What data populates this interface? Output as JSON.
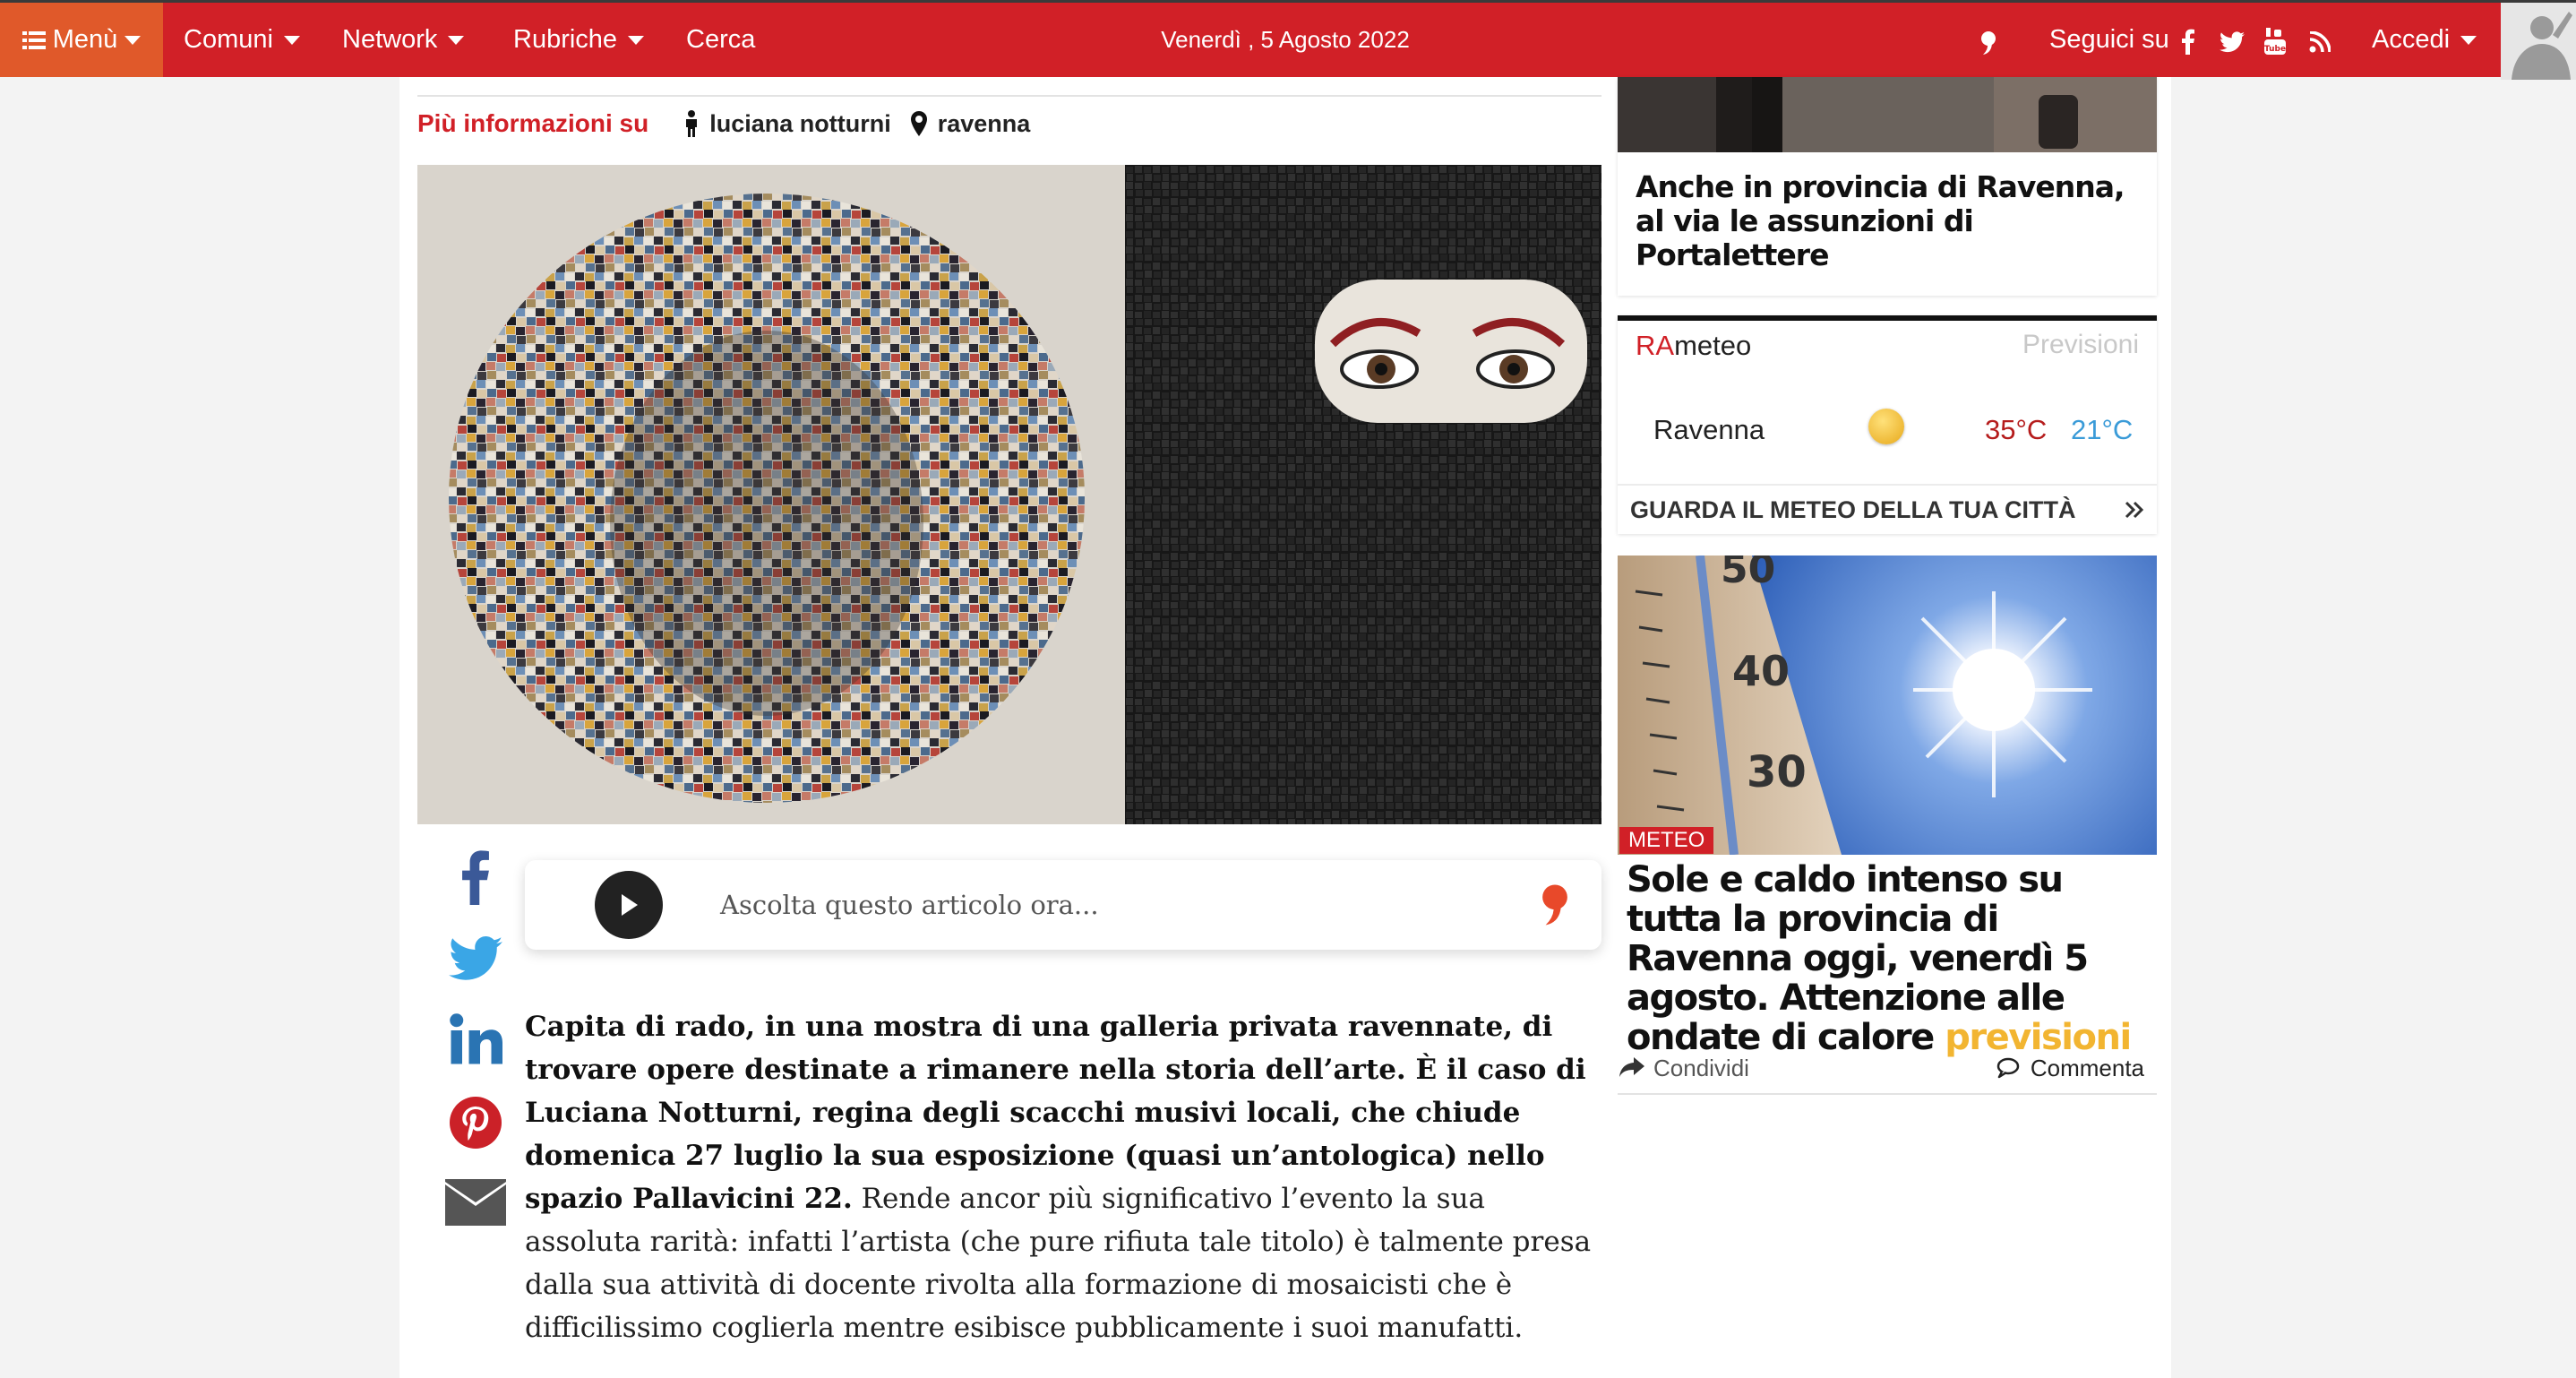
{
  "topbar": {
    "menu_label": "Menù",
    "nav": [
      {
        "label": "Comuni"
      },
      {
        "label": "Network"
      },
      {
        "label": "Rubriche"
      },
      {
        "label": "Cerca"
      }
    ],
    "date": "Venerdì , 5 Agosto 2022",
    "follow_label": "Seguici su",
    "login_label": "Accedi"
  },
  "article": {
    "more_info_label": "Più informazioni su",
    "tags": [
      {
        "icon": "person-icon",
        "label": "luciana notturni"
      },
      {
        "icon": "map-pin-icon",
        "label": "ravenna"
      }
    ],
    "listen_text": "Ascolta questo articolo ora...",
    "lead": "Capita di rado, in una mostra di una galleria privata ravennate, di trovare opere destinate a rimanere nella storia dell’arte. È il caso di Luciana Notturni, regina degli scacchi musivi locali, che chiude domenica 27 luglio la sua esposizione (quasi un’antologica) nello spazio Pallavicini 22.",
    "body": "Rende ancor più significativo l’evento la sua assoluta rarità: infatti l’artista (che pure rifiuta tale titolo) è talmente presa dalla sua attività di docente rivolta alla formazione di mosaicisti che è difficilissimo coglierla mentre esibisce pubblicamente i suoi manufatti."
  },
  "sidebar": {
    "card1_title": "Anche in provincia di Ravenna, al via le assunzioni di Portalettere",
    "meteo": {
      "title_ra": "RA",
      "title_rest": "meteo",
      "forecast_link": "Previsioni",
      "city": "Ravenna",
      "temp_max": "35°C",
      "temp_min": "21°C",
      "footer": "GUARDA IL METEO DELLA TUA CITTÀ"
    },
    "card3": {
      "badge": "METEO",
      "title": "Sole e caldo intenso su tutta la provincia di Ravenna oggi, venerdì 5 agosto. Attenzione alle ondate di calore",
      "title_tag": "previsioni",
      "share_label": "Condividi",
      "comment_label": "Commenta"
    }
  },
  "colors": {
    "brand_red": "#d12027",
    "menu_orange": "#e0592a",
    "accent_yellow": "#f2b531",
    "temp_max": "#b51c1c",
    "temp_min": "#3a9bd8"
  }
}
